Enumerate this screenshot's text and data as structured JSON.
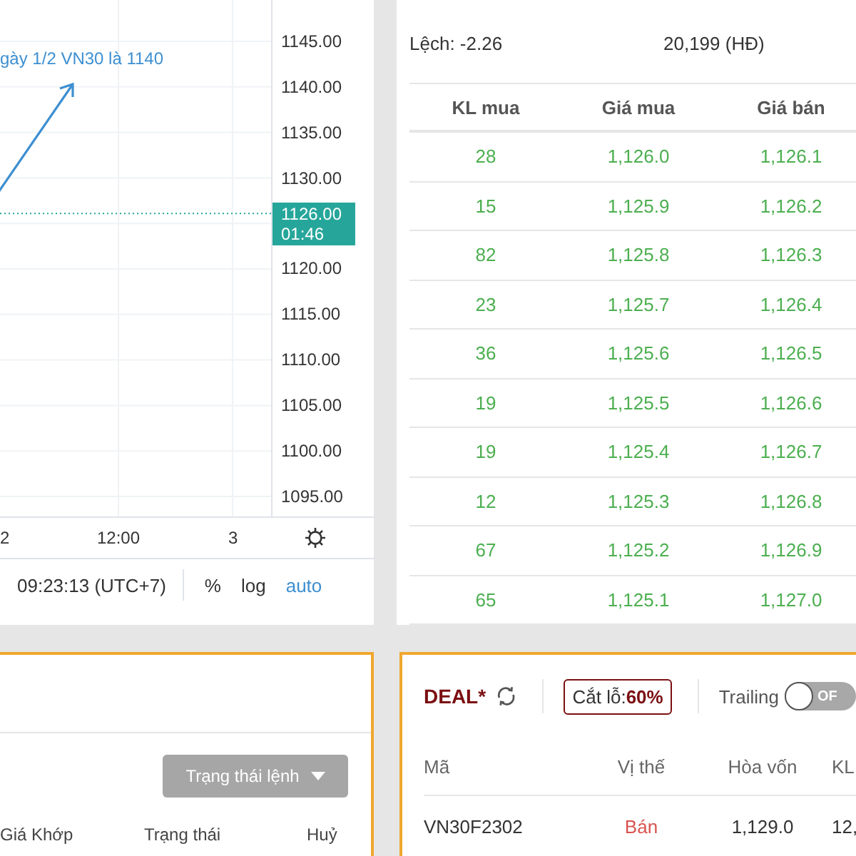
{
  "chart": {
    "annotation": "gày 1/2 VN30 là 1140",
    "price_axis": [
      {
        "kind": "tick",
        "label": "1145.00"
      },
      {
        "kind": "tick",
        "label": "1140.00"
      },
      {
        "kind": "tick",
        "label": "1135.00"
      },
      {
        "kind": "tick",
        "label": "1130.00"
      },
      {
        "kind": "current",
        "label": "1126.00",
        "timer": "01:46"
      },
      {
        "kind": "tick",
        "label": "1120.00"
      },
      {
        "kind": "tick",
        "label": "1115.00"
      },
      {
        "kind": "tick",
        "label": "1110.00"
      },
      {
        "kind": "tick",
        "label": "1105.00"
      },
      {
        "kind": "tick",
        "label": "1100.00"
      },
      {
        "kind": "tick",
        "label": "1095.00"
      }
    ],
    "time_axis": [
      "2",
      "12:00",
      "3"
    ],
    "clock": "09:23:13 (UTC+7)",
    "scale_buttons": [
      {
        "label": "%",
        "selected": false
      },
      {
        "label": "log",
        "selected": false
      },
      {
        "label": "auto",
        "selected": true
      }
    ]
  },
  "order_book": {
    "difference": "Lệch: -2.26",
    "contracts": "20,199 (HĐ)",
    "columns": [
      "KL mua",
      "Giá mua",
      "Giá bán"
    ],
    "rows": [
      [
        "28",
        "1,126.0",
        "1,126.1"
      ],
      [
        "15",
        "1,125.9",
        "1,126.2"
      ],
      [
        "82",
        "1,125.8",
        "1,126.3"
      ],
      [
        "23",
        "1,125.7",
        "1,126.4"
      ],
      [
        "36",
        "1,125.6",
        "1,126.5"
      ],
      [
        "19",
        "1,125.5",
        "1,126.6"
      ],
      [
        "19",
        "1,125.4",
        "1,126.7"
      ],
      [
        "12",
        "1,125.3",
        "1,126.8"
      ],
      [
        "67",
        "1,125.2",
        "1,126.9"
      ],
      [
        "65",
        "1,125.1",
        "1,127.0"
      ]
    ]
  },
  "orders": {
    "status_filter": "Trạng thái lệnh",
    "columns": [
      "Giá Khớp",
      "Trạng thái",
      "Huỷ"
    ]
  },
  "deal": {
    "title": "DEAL*",
    "stop_loss_label": "Cắt lỗ:",
    "stop_loss_value": "60%",
    "trailing_label": "Trailing",
    "trailing": {
      "on": false,
      "label": "OF"
    },
    "columns": [
      "Mã",
      "Vị thế",
      "Hòa vốn",
      "KL"
    ],
    "rows": [
      {
        "symbol": "VN30F2302",
        "position": "Bán",
        "color": "#d9534f",
        "breakeven": "1,129.0",
        "volume": "12,"
      }
    ]
  }
}
